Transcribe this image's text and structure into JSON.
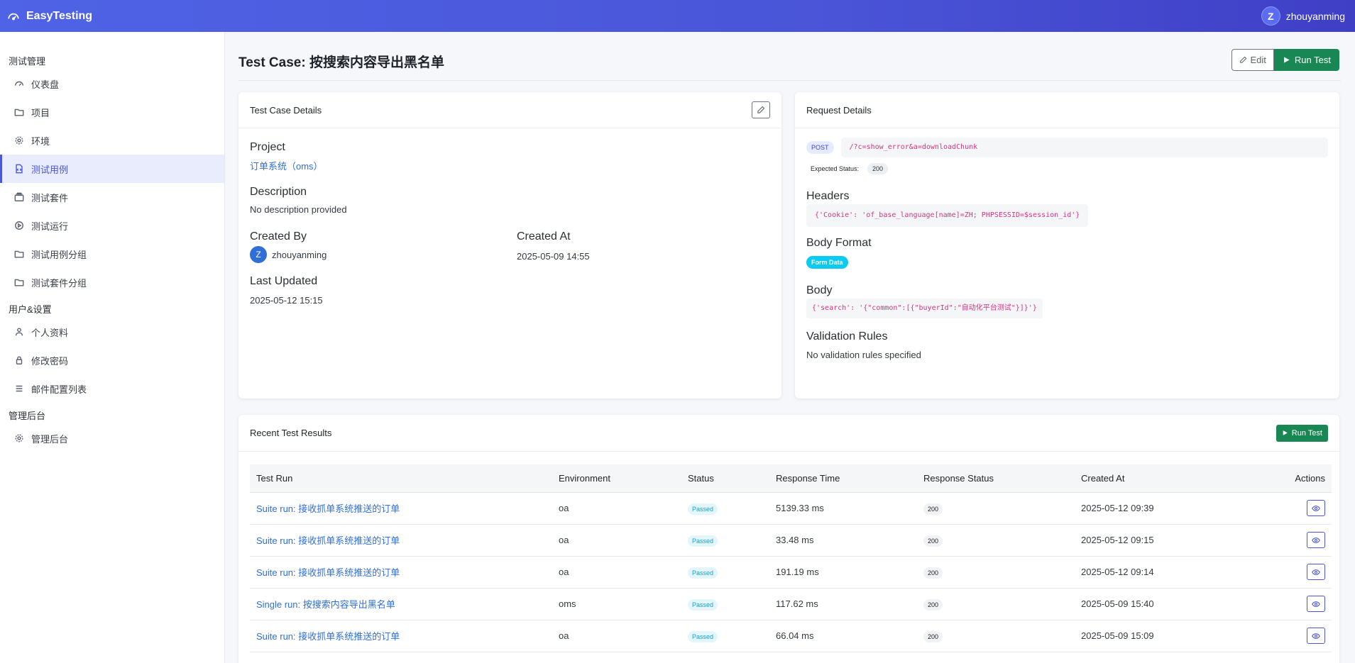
{
  "app": {
    "brand": "EasyTesting",
    "user_initial": "Z",
    "user_name": "zhouyanming"
  },
  "sidebar": {
    "sections": [
      {
        "title": "测试管理",
        "items": [
          {
            "label": "仪表盘",
            "icon": "dashboard-icon"
          },
          {
            "label": "项目",
            "icon": "folder-icon"
          },
          {
            "label": "环境",
            "icon": "gear-icon"
          },
          {
            "label": "测试用例",
            "icon": "file-code-icon",
            "active": true
          },
          {
            "label": "测试套件",
            "icon": "collection-icon"
          },
          {
            "label": "测试运行",
            "icon": "play-circle-icon"
          },
          {
            "label": "测试用例分组",
            "icon": "folder-icon"
          },
          {
            "label": "测试套件分组",
            "icon": "folder-icon"
          }
        ]
      },
      {
        "title": "用户&设置",
        "items": [
          {
            "label": "个人资料",
            "icon": "person-icon"
          },
          {
            "label": "修改密码",
            "icon": "lock-icon"
          },
          {
            "label": "邮件配置列表",
            "icon": "list-icon"
          }
        ]
      },
      {
        "title": "管理后台",
        "items": [
          {
            "label": "管理后台",
            "icon": "gear-icon"
          }
        ]
      }
    ]
  },
  "header": {
    "title": "Test Case: 按搜索内容导出黑名单",
    "edit_label": "Edit",
    "run_label": "Run Test"
  },
  "details": {
    "card_title": "Test Case Details",
    "project_label": "Project",
    "project_value": "订单系统（oms）",
    "description_label": "Description",
    "description_value": "No description provided",
    "created_by_label": "Created By",
    "created_by_initial": "Z",
    "created_by_value": "zhouyanming",
    "created_at_label": "Created At",
    "created_at_value": "2025-05-09 14:55",
    "updated_label": "Last Updated",
    "updated_value": "2025-05-12 15:15"
  },
  "request": {
    "card_title": "Request Details",
    "method": "POST",
    "url": "/?c=show_error&a=downloadChunk",
    "expected_label": "Expected Status:",
    "expected_value": "200",
    "headers_label": "Headers",
    "headers_value": "{'Cookie': 'of_base_language[name]=ZH; PHPSESSID=$session_id'}",
    "body_format_label": "Body Format",
    "body_format_value": "Form Data",
    "body_label": "Body",
    "body_value": "{'search': '{\"common\":[{\"buyerId\":\"自动化平台测试\"}]}'}",
    "validation_label": "Validation Rules",
    "validation_value": "No validation rules specified"
  },
  "results": {
    "card_title": "Recent Test Results",
    "run_label": "Run Test",
    "columns": [
      "Test Run",
      "Environment",
      "Status",
      "Response Time",
      "Response Status",
      "Created At",
      "Actions"
    ],
    "rows": [
      {
        "run": "Suite run: 接收抓单系统推送的订单",
        "env": "oa",
        "status": "Passed",
        "time": "5139.33 ms",
        "code": "200",
        "created": "2025-05-12 09:39"
      },
      {
        "run": "Suite run: 接收抓单系统推送的订单",
        "env": "oa",
        "status": "Passed",
        "time": "33.48 ms",
        "code": "200",
        "created": "2025-05-12 09:15"
      },
      {
        "run": "Suite run: 接收抓单系统推送的订单",
        "env": "oa",
        "status": "Passed",
        "time": "191.19 ms",
        "code": "200",
        "created": "2025-05-12 09:14"
      },
      {
        "run": "Single run: 按搜索内容导出黑名单",
        "env": "oms",
        "status": "Passed",
        "time": "117.62 ms",
        "code": "200",
        "created": "2025-05-09 15:40"
      },
      {
        "run": "Suite run: 接收抓单系统推送的订单",
        "env": "oa",
        "status": "Passed",
        "time": "66.04 ms",
        "code": "200",
        "created": "2025-05-09 15:09"
      }
    ]
  }
}
